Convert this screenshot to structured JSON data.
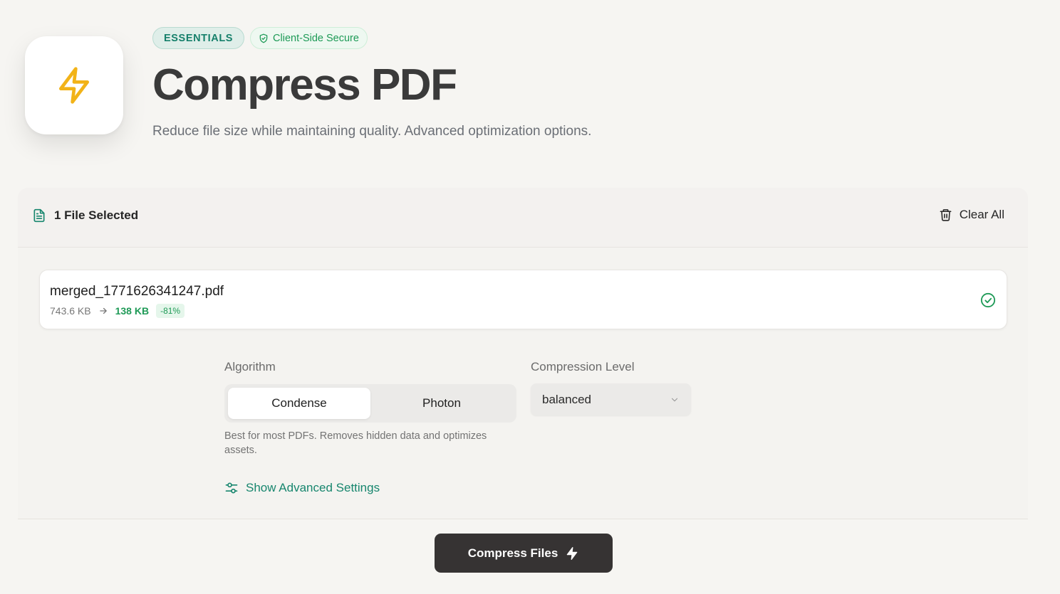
{
  "header": {
    "badge_essentials": "ESSENTIALS",
    "badge_secure": "Client-Side Secure",
    "title": "Compress PDF",
    "subtitle": "Reduce file size while maintaining quality. Advanced optimization options.",
    "icon": "lightning-icon",
    "accent_color": "#f2b318"
  },
  "files": {
    "count_label": "1 File Selected",
    "clear_label": "Clear All",
    "items": [
      {
        "name": "merged_1771626341247.pdf",
        "original_size": "743.6 KB",
        "compressed_size": "138 KB",
        "reduction": "-81%",
        "status": "done"
      }
    ]
  },
  "settings": {
    "algorithm_label": "Algorithm",
    "algorithm_options": [
      "Condense",
      "Photon"
    ],
    "algorithm_selected": "Condense",
    "algorithm_help": "Best for most PDFs. Removes hidden data and optimizes assets.",
    "level_label": "Compression Level",
    "level_value": "balanced",
    "advanced_label": "Show Advanced Settings"
  },
  "actions": {
    "compress_label": "Compress Files"
  },
  "colors": {
    "brand_green": "#17866e",
    "success_green": "#1f9a57",
    "dark_button": "#363333"
  }
}
